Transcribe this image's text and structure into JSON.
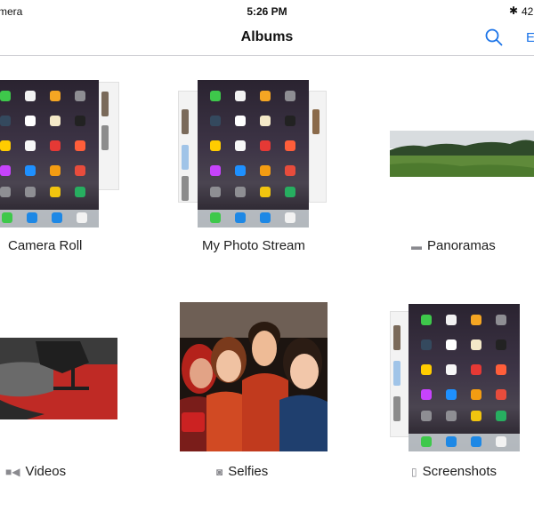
{
  "status_bar": {
    "carrier": "mera",
    "time": "5:26 PM",
    "battery_text": "42"
  },
  "nav": {
    "title": "Albums",
    "edit_label": "E"
  },
  "albums": [
    {
      "label": "Camera Roll"
    },
    {
      "label": "My Photo Stream"
    },
    {
      "label": "Panoramas",
      "icon": "panorama-icon"
    },
    {
      "label": "Videos",
      "icon": "video-camera-icon"
    },
    {
      "label": "Selfies",
      "icon": "camera-icon"
    },
    {
      "label": "Screenshots",
      "icon": "phone-icon"
    }
  ],
  "colors": {
    "accent": "#1a73e8",
    "video_red": "#bf2a25"
  }
}
